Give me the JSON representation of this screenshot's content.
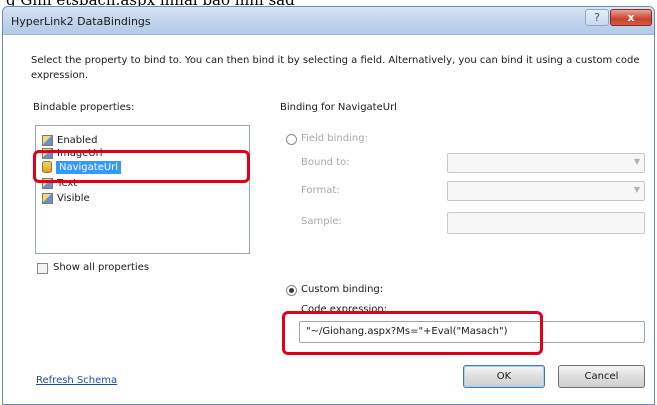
{
  "caption": "g Gini etsbach.aspx inhal bao inhi sad",
  "window": {
    "title": "HyperLink2 DataBindings",
    "help_glyph": "?",
    "close_glyph": "x"
  },
  "intro": "Select the property to bind to. You can then bind it by selecting a field. Alternatively, you can bind it using a custom code expression.",
  "bindable": {
    "heading": "Bindable properties:",
    "items": [
      {
        "label": "Enabled",
        "icon": "property-icon"
      },
      {
        "label": "ImageUrl",
        "icon": "property-icon"
      },
      {
        "label": "NavigateUrl",
        "icon": "database-icon",
        "selected": true
      },
      {
        "label": "Text",
        "icon": "property-icon"
      },
      {
        "label": "Visible",
        "icon": "property-icon"
      }
    ],
    "show_all_label": "Show all properties"
  },
  "binding": {
    "heading": "Binding for NavigateUrl",
    "field_binding_label": "Field binding:",
    "bound_to_label": "Bound to:",
    "format_label": "Format:",
    "sample_label": "Sample:",
    "custom_binding_label": "Custom binding:",
    "code_expression_label": "Code expression:",
    "code_expression_value": "\"~/Giohang.aspx?Ms=\"+Eval(\"Masach\")"
  },
  "footer": {
    "refresh_schema": "Refresh Schema",
    "ok": "OK",
    "cancel": "Cancel"
  },
  "colors": {
    "highlight": "#e0001b",
    "selection": "#3399ff"
  }
}
